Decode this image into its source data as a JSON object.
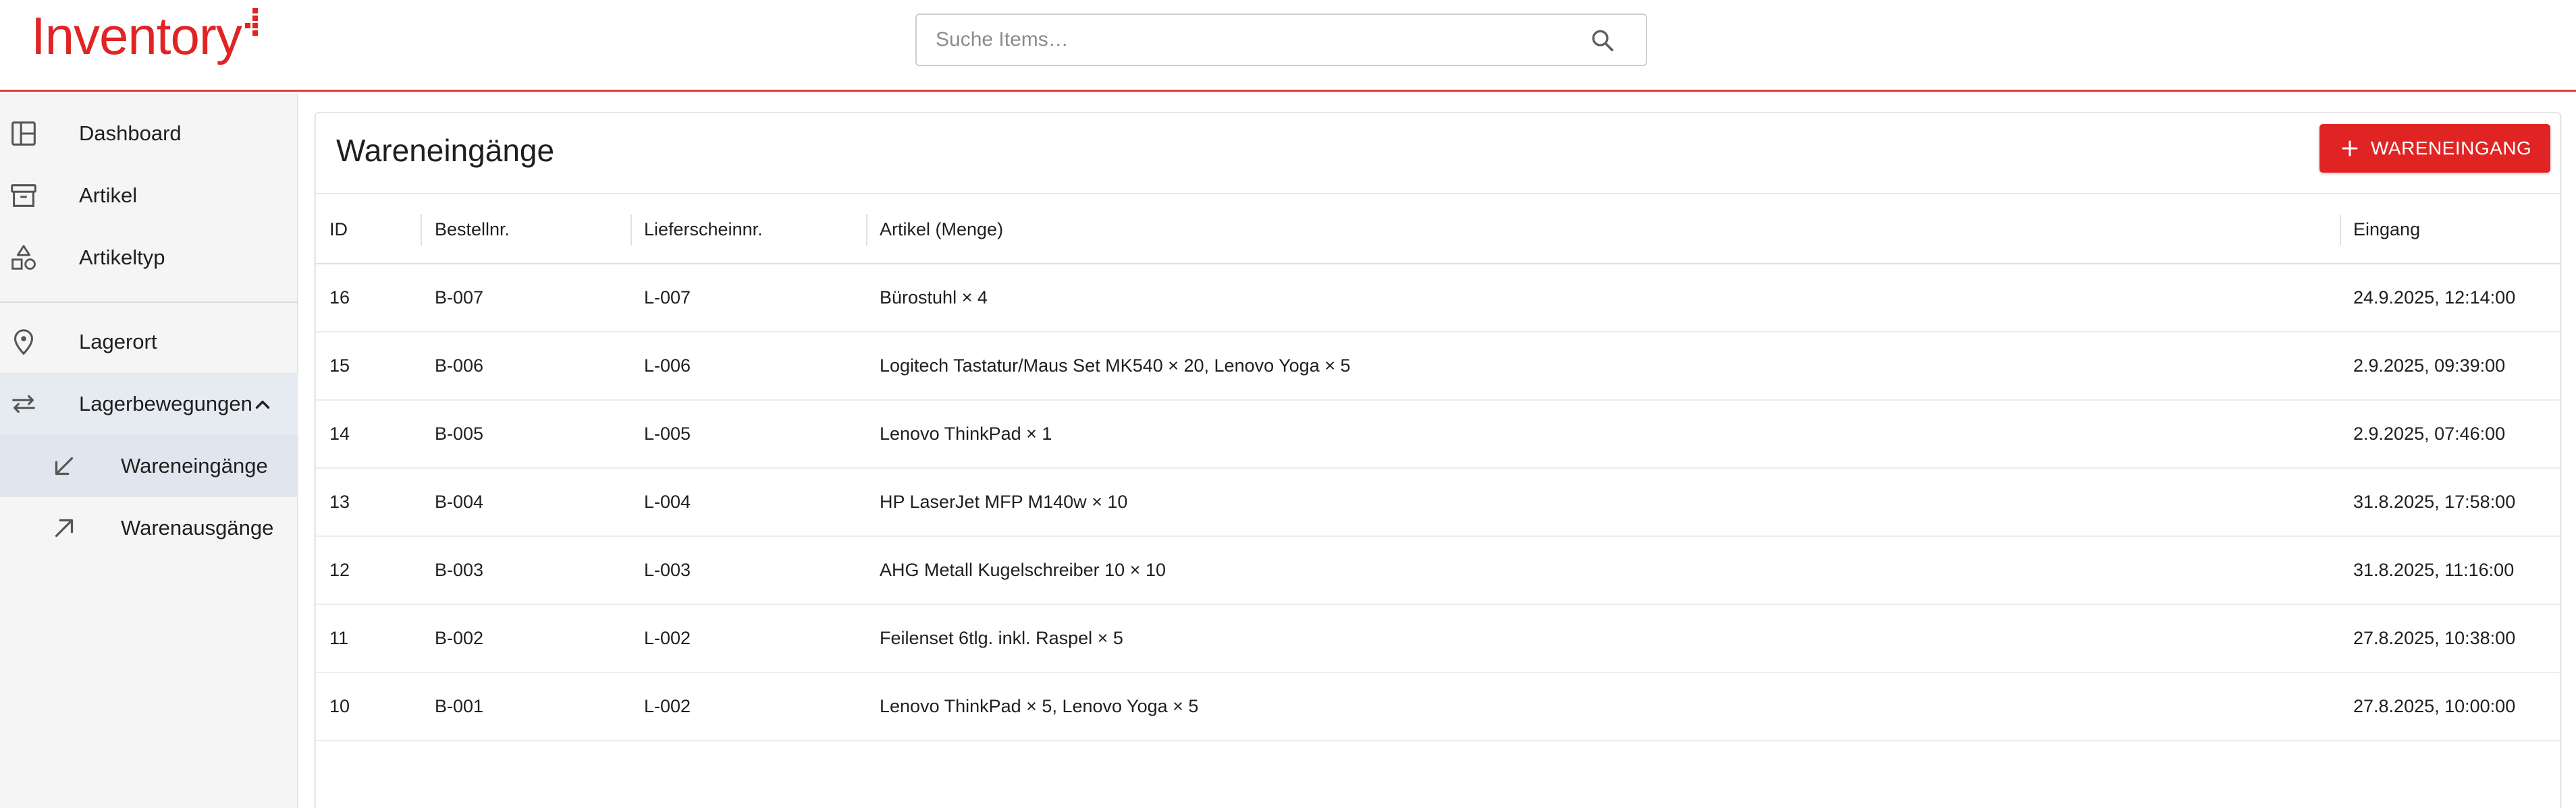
{
  "app": {
    "logo_text": "Inventory",
    "accent_color": "#e02424"
  },
  "search": {
    "placeholder": "Suche Items…",
    "value": "",
    "icon": "search-icon"
  },
  "sidebar": {
    "items": [
      {
        "label": "Dashboard",
        "icon": "dashboard-icon"
      },
      {
        "label": "Artikel",
        "icon": "archive-box-icon"
      },
      {
        "label": "Artikeltyp",
        "icon": "shapes-icon"
      },
      {
        "label": "Lagerort",
        "icon": "location-pin-icon"
      },
      {
        "label": "Lagerbewegungen",
        "icon": "swap-arrows-icon",
        "expanded": true
      },
      {
        "label": "Wareneingänge",
        "icon": "arrow-down-left-icon",
        "active": true
      },
      {
        "label": "Warenausgänge",
        "icon": "arrow-up-right-icon"
      }
    ]
  },
  "page": {
    "title": "Wareneingänge",
    "add_button_label": "WARENEINGANG"
  },
  "table": {
    "columns": [
      "ID",
      "Bestellnr.",
      "Lieferscheinnr.",
      "Artikel (Menge)",
      "Eingang"
    ],
    "rows": [
      {
        "id": "16",
        "bestellnr": "B-007",
        "lieferscheinnr": "L-007",
        "artikel": "Bürostuhl × 4",
        "eingang": "24.9.2025, 12:14:00"
      },
      {
        "id": "15",
        "bestellnr": "B-006",
        "lieferscheinnr": "L-006",
        "artikel": "Logitech Tastatur/Maus Set MK540 × 20, Lenovo Yoga × 5",
        "eingang": "2.9.2025, 09:39:00"
      },
      {
        "id": "14",
        "bestellnr": "B-005",
        "lieferscheinnr": "L-005",
        "artikel": "Lenovo ThinkPad × 1",
        "eingang": "2.9.2025, 07:46:00"
      },
      {
        "id": "13",
        "bestellnr": "B-004",
        "lieferscheinnr": "L-004",
        "artikel": "HP LaserJet MFP M140w × 10",
        "eingang": "31.8.2025, 17:58:00"
      },
      {
        "id": "12",
        "bestellnr": "B-003",
        "lieferscheinnr": "L-003",
        "artikel": "AHG Metall Kugelschreiber 10 × 10",
        "eingang": "31.8.2025, 11:16:00"
      },
      {
        "id": "11",
        "bestellnr": "B-002",
        "lieferscheinnr": "L-002",
        "artikel": "Feilenset 6tlg. inkl. Raspel × 5",
        "eingang": "27.8.2025, 10:38:00"
      },
      {
        "id": "10",
        "bestellnr": "B-001",
        "lieferscheinnr": "L-002",
        "artikel": "Lenovo ThinkPad × 5, Lenovo Yoga × 5",
        "eingang": "27.8.2025, 10:00:00"
      }
    ]
  }
}
